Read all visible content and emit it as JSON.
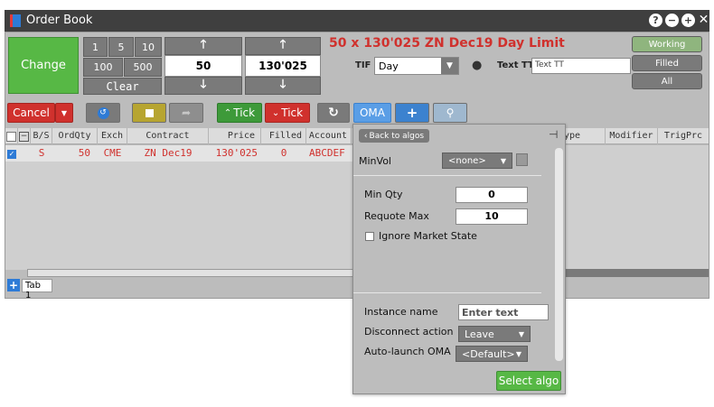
{
  "window": {
    "title": "Order Book"
  },
  "qty_buttons": [
    "1",
    "5",
    "10",
    "100",
    "500"
  ],
  "clear_label": "Clear",
  "change_label": "Change",
  "qty_value": "50",
  "price_value": "130'025",
  "order_title": "50 x 130'025 ZN Dec19 Day Limit",
  "tif": {
    "label": "TIF",
    "value": "Day"
  },
  "text_tt": {
    "label": "Text TT",
    "value": "Text TT"
  },
  "state_buttons": [
    "Working",
    "Filled",
    "All"
  ],
  "toolbar": {
    "cancel_label": "Cancel",
    "tick_up_label": "Tick",
    "tick_down_label": "Tick",
    "oma_label": "OMA"
  },
  "columns": [
    "B/S",
    "OrdQty",
    "Exch",
    "Contract",
    "Price",
    "Filled",
    "Account",
    "ype",
    "Modifier",
    "TrigPrc"
  ],
  "rows": [
    {
      "bs": "S",
      "qty": "50",
      "exch": "CME",
      "contract": "ZN Dec19",
      "price": "130'025",
      "filled": "0",
      "account": "ABCDEF"
    }
  ],
  "tab_label": "Tab 1",
  "algo_panel": {
    "back_label": "Back to algos",
    "minvol_label": "MinVol",
    "minvol_value": "<none>",
    "min_qty_label": "Min Qty",
    "min_qty_value": "0",
    "requote_label": "Requote Max",
    "requote_value": "10",
    "ignore_label": "Ignore Market State",
    "instance_label": "Instance name",
    "instance_placeholder": "Enter text",
    "disconnect_label": "Disconnect action",
    "disconnect_value": "Leave",
    "autolaunch_label": "Auto-launch OMA",
    "autolaunch_value": "<Default>",
    "select_label": "Select algo"
  }
}
